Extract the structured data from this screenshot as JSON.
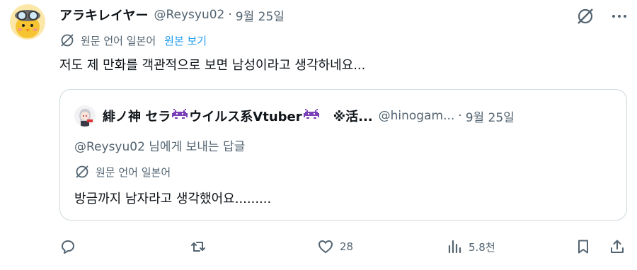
{
  "tweet": {
    "display_name": "アラキレイヤー",
    "handle": "@Reysyu02",
    "separator": "·",
    "date": "9월 25일",
    "translate_label": "원문 언어 일본어",
    "translate_link": "원본 보기",
    "text": "저도 제 만화를 객관적으로 보면 남성이라고 생각하네요..."
  },
  "quoted": {
    "display_name_part1": "緋ノ神 セラ ",
    "display_name_part2": "ウイルス系Vtuber",
    "display_name_part3": "　※活...",
    "handle": "@hinogam...",
    "separator": "·",
    "date": "9월 25일",
    "reply_to": "@Reysyu02 님에게 보내는 답글",
    "translate_label": "원문 언어 일본어",
    "text": "방금까지 남자라고 생각했어요........."
  },
  "actions": {
    "reply_count": "",
    "retweet_count": "",
    "like_count": "28",
    "views_count": "5.8천"
  },
  "colors": {
    "accent": "#1d9bf0",
    "secondary_text": "#536471",
    "invader": "#7b3fb8"
  },
  "icons": [
    "translate-globe-icon",
    "grok-icon",
    "more-icon",
    "reply-icon",
    "retweet-icon",
    "like-icon",
    "views-icon",
    "bookmark-icon",
    "share-icon"
  ]
}
